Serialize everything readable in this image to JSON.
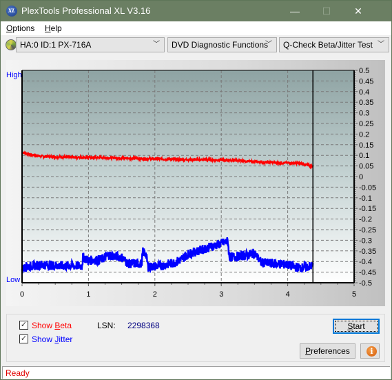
{
  "window": {
    "title": "PlexTools Professional XL V3.16",
    "icon_text": "XL",
    "minimize_glyph": "—",
    "maximize_glyph": "☐",
    "close_glyph": "✕"
  },
  "menu": {
    "items": [
      {
        "label": "Options",
        "mnemonic": "O",
        "rest": "ptions"
      },
      {
        "label": "Help",
        "mnemonic": "H",
        "rest": "elp"
      }
    ]
  },
  "toolbar": {
    "drive": "HA:0 ID:1  PX-716A",
    "function": "DVD Diagnostic Functions",
    "test": "Q-Check Beta/Jitter Test",
    "chevron": "﹀"
  },
  "chart_data": {
    "type": "line",
    "title": "",
    "xlabel": "",
    "ylabel_left_top": "High",
    "ylabel_left_bottom": "Low",
    "xlim": [
      0,
      5
    ],
    "ylim": [
      -0.5,
      0.5
    ],
    "x_ticks": [
      "0",
      "1",
      "2",
      "3",
      "4",
      "5"
    ],
    "y_ticks": [
      "0.5",
      "0.45",
      "0.4",
      "0.35",
      "0.3",
      "0.25",
      "0.2",
      "0.15",
      "0.1",
      "0.05",
      "0",
      "-0.05",
      "-0.1",
      "-0.15",
      "-0.2",
      "-0.25",
      "-0.3",
      "-0.35",
      "-0.4",
      "-0.45",
      "-0.5"
    ],
    "grid": true,
    "end_marker_x": 4.38,
    "series": [
      {
        "name": "Beta",
        "color": "#ff0000",
        "x": [
          0,
          0.1,
          0.3,
          0.6,
          1.0,
          1.4,
          1.8,
          2.0,
          2.2,
          2.4,
          2.6,
          2.8,
          3.0,
          3.2,
          3.4,
          3.6,
          3.8,
          4.0,
          4.2,
          4.3,
          4.38
        ],
        "y": [
          0.115,
          0.105,
          0.095,
          0.092,
          0.09,
          0.088,
          0.084,
          0.083,
          0.082,
          0.08,
          0.08,
          0.079,
          0.078,
          0.076,
          0.072,
          0.068,
          0.066,
          0.064,
          0.062,
          0.053,
          0.047
        ]
      },
      {
        "name": "Jitter",
        "color": "#0000ff",
        "x": [
          0,
          0.05,
          0.3,
          0.6,
          0.9,
          0.92,
          1.0,
          1.2,
          1.3,
          1.5,
          1.6,
          1.8,
          1.82,
          1.86,
          1.9,
          2.1,
          2.3,
          2.4,
          2.5,
          2.6,
          2.8,
          3.0,
          3.1,
          3.12,
          3.4,
          3.5,
          3.6,
          3.8,
          4.0,
          4.1,
          4.2,
          4.38
        ],
        "y": [
          -0.44,
          -0.425,
          -0.415,
          -0.42,
          -0.42,
          -0.38,
          -0.395,
          -0.39,
          -0.37,
          -0.38,
          -0.41,
          -0.41,
          -0.355,
          -0.36,
          -0.425,
          -0.42,
          -0.405,
          -0.39,
          -0.365,
          -0.355,
          -0.335,
          -0.315,
          -0.305,
          -0.38,
          -0.37,
          -0.36,
          -0.405,
          -0.41,
          -0.415,
          -0.425,
          -0.43,
          -0.42
        ]
      }
    ]
  },
  "options": {
    "show_beta": {
      "label_prefix": "Show ",
      "mnemonic": "B",
      "rest": "eta",
      "checked": true,
      "color": "#ff0000"
    },
    "show_jitter": {
      "label_prefix": "Show ",
      "mnemonic": "J",
      "rest": "itter",
      "checked": true,
      "color": "#0000ff"
    },
    "lsn_label": "LSN:",
    "lsn_value": "2298368",
    "check_glyph": "✓"
  },
  "buttons": {
    "start": {
      "mnemonic": "S",
      "rest": "tart"
    },
    "preferences": {
      "mnemonic": "P",
      "rest": "references"
    },
    "info_glyph": "i"
  },
  "status": {
    "text": "Ready"
  }
}
